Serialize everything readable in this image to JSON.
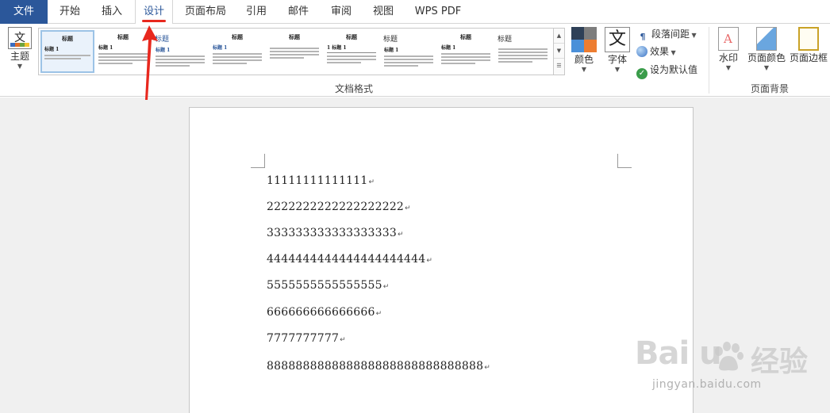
{
  "tabs": [
    {
      "label": "文件"
    },
    {
      "label": "开始"
    },
    {
      "label": "插入"
    },
    {
      "label": "设计"
    },
    {
      "label": "页面布局"
    },
    {
      "label": "引用"
    },
    {
      "label": "邮件"
    },
    {
      "label": "审阅"
    },
    {
      "label": "视图"
    },
    {
      "label": "WPS PDF"
    }
  ],
  "ribbon": {
    "theme": {
      "label": "主题",
      "icon": "文"
    },
    "style_gallery": [
      {
        "title": "标题",
        "sub": "标题 1"
      },
      {
        "title": "标题",
        "sub": "标题 1"
      },
      {
        "title": "标题",
        "sub": "标题 1"
      },
      {
        "title": "标题",
        "sub": "标题 1"
      },
      {
        "title": "标题",
        "sub": ""
      },
      {
        "title": "标题",
        "sub": "1 标题 1"
      },
      {
        "title": "标题",
        "sub": "标题 1"
      },
      {
        "title": "标题",
        "sub": "标题 1"
      },
      {
        "title": "标题",
        "sub": ""
      }
    ],
    "colors": {
      "label": "颜色"
    },
    "fonts": {
      "label": "字体",
      "icon": "文"
    },
    "paragraph_spacing": {
      "label": "段落间距"
    },
    "effects": {
      "label": "效果"
    },
    "set_default": {
      "label": "设为默认值"
    },
    "group_document_format": "文档格式",
    "watermark": {
      "label": "水印"
    },
    "page_color": {
      "label": "页面颜色"
    },
    "page_border": {
      "label": "页面边框"
    },
    "group_page_background": "页面背景"
  },
  "document": {
    "lines": [
      "11111111111111",
      "2222222222222222222",
      "333333333333333333",
      "4444444444444444444444",
      "5555555555555555",
      "666666666666666",
      "7777777777",
      "888888888888888888888888888888"
    ],
    "paragraph_mark": "↵"
  },
  "watermark": {
    "brand": "Bai  u",
    "cn": "经验",
    "url": "jingyan.baidu.com"
  }
}
